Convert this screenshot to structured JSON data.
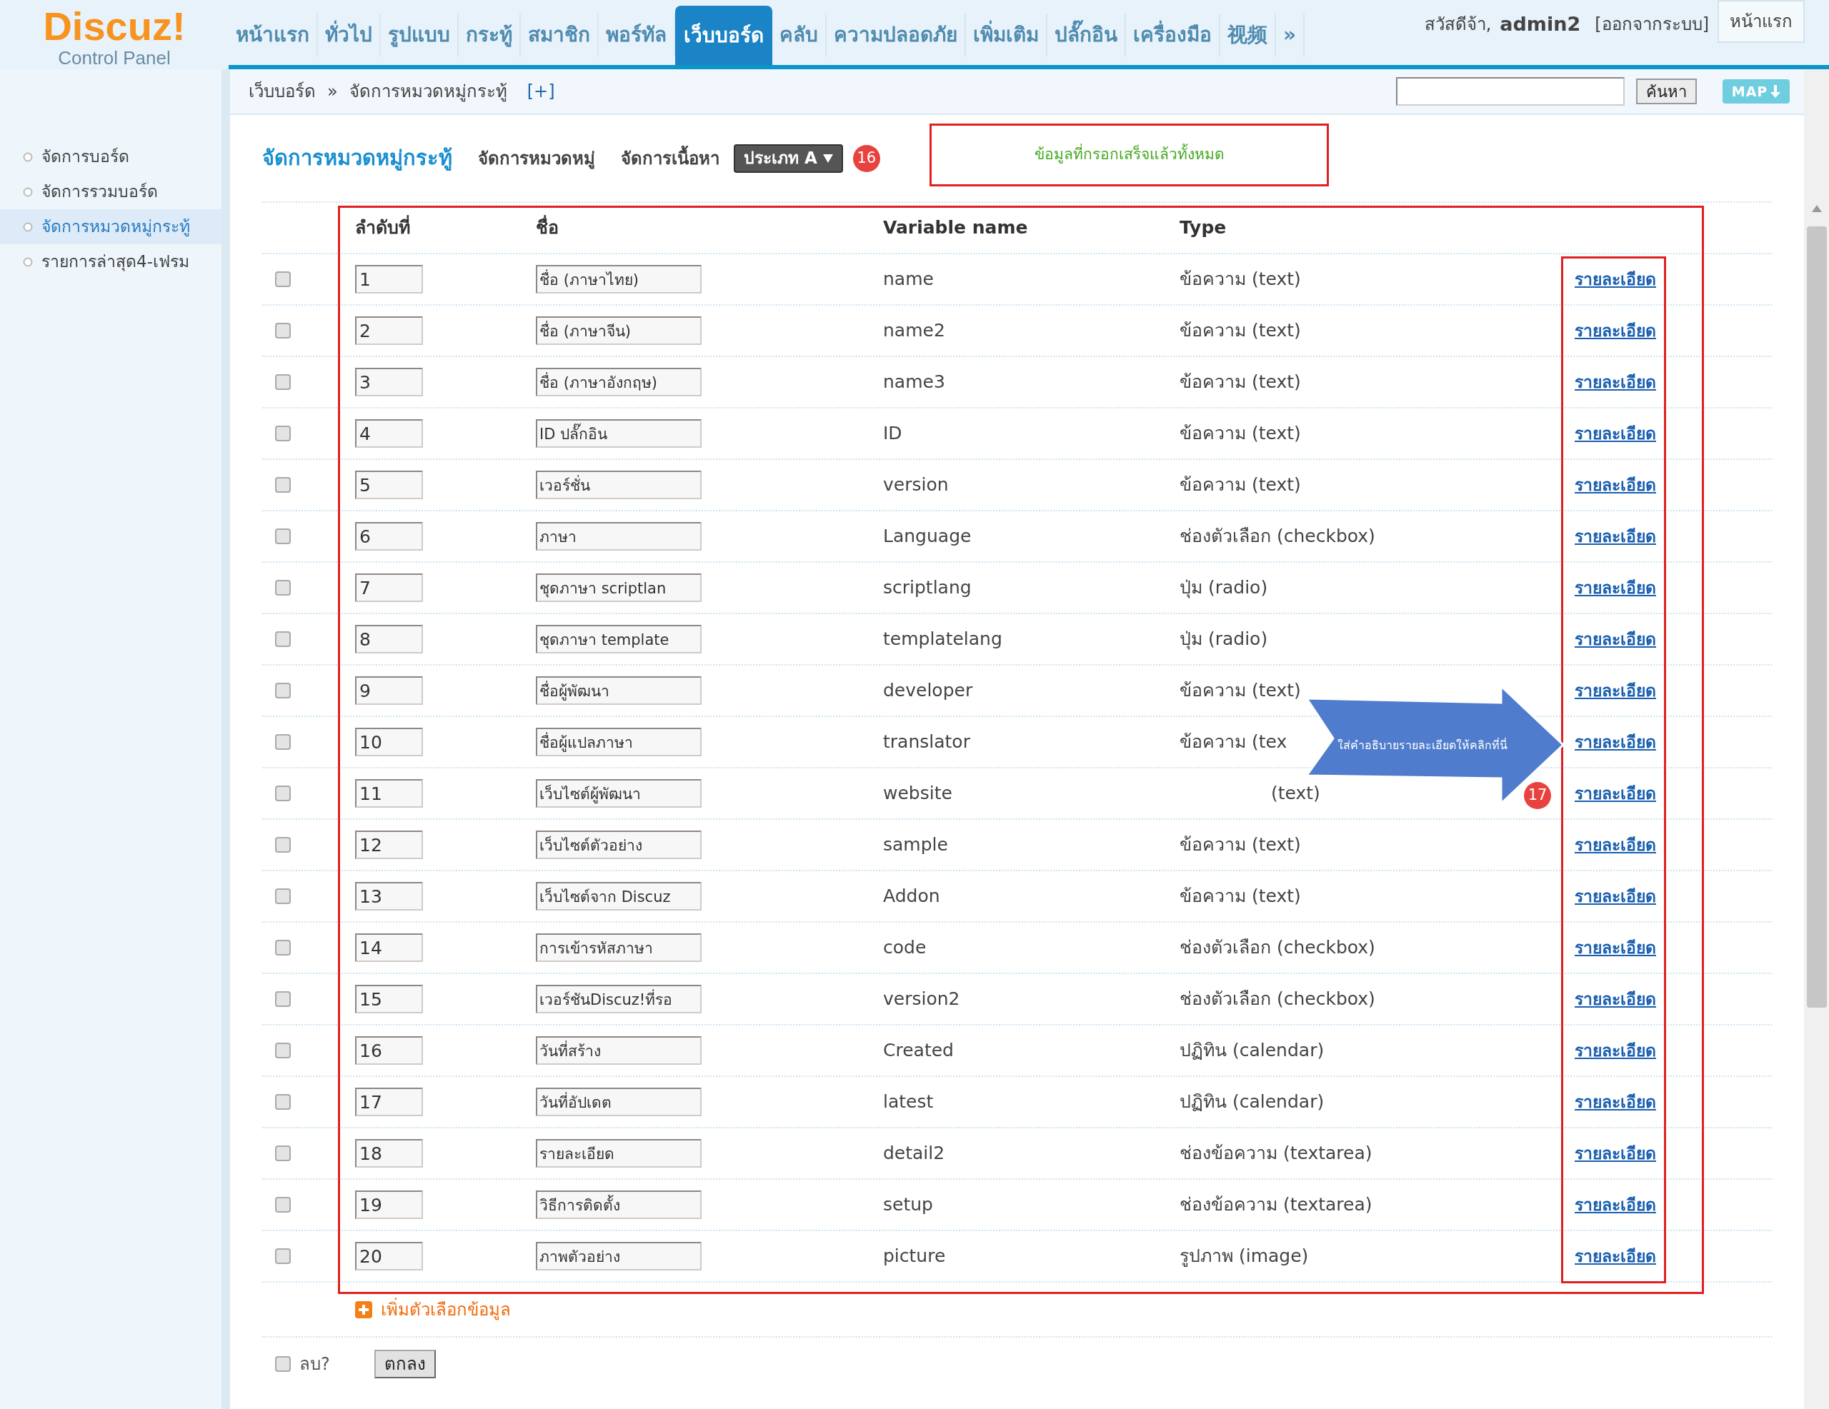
{
  "logo": {
    "title": "Discuz!",
    "subtitle": "Control Panel"
  },
  "nav": [
    {
      "label": "หน้าแรก",
      "selected": false
    },
    {
      "label": "ทั่วไป",
      "selected": false
    },
    {
      "label": "รูปแบบ",
      "selected": false
    },
    {
      "label": "กระทู้",
      "selected": false
    },
    {
      "label": "สมาชิก",
      "selected": false
    },
    {
      "label": "พอร์ทัล",
      "selected": false
    },
    {
      "label": "เว็บบอร์ด",
      "selected": true
    },
    {
      "label": "คลับ",
      "selected": false
    },
    {
      "label": "ความปลอดภัย",
      "selected": false
    },
    {
      "label": "เพิ่มเติม",
      "selected": false
    },
    {
      "label": "ปลั๊กอิน",
      "selected": false
    },
    {
      "label": "เครื่องมือ",
      "selected": false
    },
    {
      "label": "视频",
      "selected": false
    },
    {
      "label": "»",
      "selected": false
    }
  ],
  "user": {
    "greeting": "สวัสดีจ้า,",
    "name": "admin2",
    "logout": "[ออกจากระบบ]"
  },
  "home_button": "หน้าแรก",
  "breadcrumb": {
    "parent": "เว็บบอร์ด",
    "separator": "»",
    "current": "จัดการหมวดหมู่กระทู้",
    "add": "[+]"
  },
  "search": {
    "button": "ค้นหา"
  },
  "map_button": "MAP",
  "sidebar": [
    {
      "label": "จัดการบอร์ด",
      "selected": false
    },
    {
      "label": "จัดการรวมบอร์ด",
      "selected": false
    },
    {
      "label": "จัดการหมวดหมู่กระทู้",
      "selected": true
    },
    {
      "label": "รายการล่าสุด4-เฟรม",
      "selected": false
    }
  ],
  "page_tabs": [
    {
      "label": "จัดการหมวดหมู่กระทู้",
      "selected": true
    },
    {
      "label": "จัดการหมวดหมู่",
      "selected": false
    },
    {
      "label": "จัดการเนื้อหา",
      "selected": false
    }
  ],
  "type_dropdown": "ประเภท A",
  "note_badge": "16",
  "note": "ข้อมูลที่กรอกเสร็จแล้วทั้งหมด",
  "table": {
    "columns": [
      "ลำดับที่",
      "ชื่อ",
      "Variable name",
      "Type"
    ],
    "rows": [
      {
        "checked": false,
        "order": "1",
        "name": "ชื่อ (ภาษาไทย)",
        "variable": "name",
        "type": "ข้อความ (text)",
        "link": "รายละเอียด"
      },
      {
        "checked": false,
        "order": "2",
        "name": "ชื่อ (ภาษาจีน)",
        "variable": "name2",
        "type": "ข้อความ (text)",
        "link": "รายละเอียด"
      },
      {
        "checked": false,
        "order": "3",
        "name": "ชื่อ (ภาษาอังกฤษ)",
        "variable": "name3",
        "type": "ข้อความ (text)",
        "link": "รายละเอียด"
      },
      {
        "checked": false,
        "order": "4",
        "name": "ID ปลั๊กอิน",
        "variable": "ID",
        "type": "ข้อความ (text)",
        "link": "รายละเอียด"
      },
      {
        "checked": false,
        "order": "5",
        "name": "เวอร์ชั่น",
        "variable": "version",
        "type": "ข้อความ (text)",
        "link": "รายละเอียด"
      },
      {
        "checked": false,
        "order": "6",
        "name": "ภาษา",
        "variable": "Language",
        "type": "ช่องตัวเลือก (checkbox)",
        "link": "รายละเอียด"
      },
      {
        "checked": false,
        "order": "7",
        "name": "ชุดภาษา scriptlan",
        "variable": "scriptlang",
        "type": "ปุ่ม (radio)",
        "link": "รายละเอียด"
      },
      {
        "checked": false,
        "order": "8",
        "name": "ชุดภาษา template",
        "variable": "templatelang",
        "type": "ปุ่ม (radio)",
        "link": "รายละเอียด"
      },
      {
        "checked": false,
        "order": "9",
        "name": "ชื่อผู้พัฒนา",
        "variable": "developer",
        "type": "ข้อความ (text)",
        "link": "รายละเอียด"
      },
      {
        "checked": false,
        "order": "10",
        "name": "ชื่อผู้แปลภาษา",
        "variable": "translator",
        "type": "ข้อความ (tex",
        "link": "รายละเอียด"
      },
      {
        "checked": false,
        "order": "11",
        "name": "เว็บไซต์ผู้พัฒนา",
        "variable": "website",
        "type": "(text)",
        "link": "รายละเอียด"
      },
      {
        "checked": false,
        "order": "12",
        "name": "เว็บไซต์ตัวอย่าง",
        "variable": "sample",
        "type": "ข้อความ (text)",
        "link": "รายละเอียด"
      },
      {
        "checked": false,
        "order": "13",
        "name": "เว็บไซต์จาก Discuz",
        "variable": "Addon",
        "type": "ข้อความ (text)",
        "link": "รายละเอียด"
      },
      {
        "checked": false,
        "order": "14",
        "name": "การเข้ารหัสภาษา",
        "variable": "code",
        "type": "ช่องตัวเลือก (checkbox)",
        "link": "รายละเอียด"
      },
      {
        "checked": false,
        "order": "15",
        "name": "เวอร์ชันDiscuz!ที่รอ",
        "variable": "version2",
        "type": "ช่องตัวเลือก (checkbox)",
        "link": "รายละเอียด"
      },
      {
        "checked": false,
        "order": "16",
        "name": "วันที่สร้าง",
        "variable": "Created",
        "type": "ปฏิทิน (calendar)",
        "link": "รายละเอียด"
      },
      {
        "checked": false,
        "order": "17",
        "name": "วันที่อัปเดต",
        "variable": "latest",
        "type": "ปฏิทิน (calendar)",
        "link": "รายละเอียด"
      },
      {
        "checked": false,
        "order": "18",
        "name": "รายละเอียด",
        "variable": "detail2",
        "type": "ช่องข้อความ (textarea)",
        "link": "รายละเอียด"
      },
      {
        "checked": false,
        "order": "19",
        "name": "วิธีการติดตั้ง",
        "variable": "setup",
        "type": "ช่องข้อความ (textarea)",
        "link": "รายละเอียด"
      },
      {
        "checked": false,
        "order": "20",
        "name": "ภาพตัวอย่าง",
        "variable": "picture",
        "type": "รูปภาพ (image)",
        "link": "รายละเอียด"
      }
    ]
  },
  "add_option": "เพิ่มตัวเลือกข้อมูล",
  "delete": {
    "label": "ลบ?",
    "checked": false
  },
  "submit": "ตกลง",
  "callout": {
    "text": "ใส่คำอธิบายรายละเอียดให้คลิกที่นี่",
    "badge": "17"
  }
}
